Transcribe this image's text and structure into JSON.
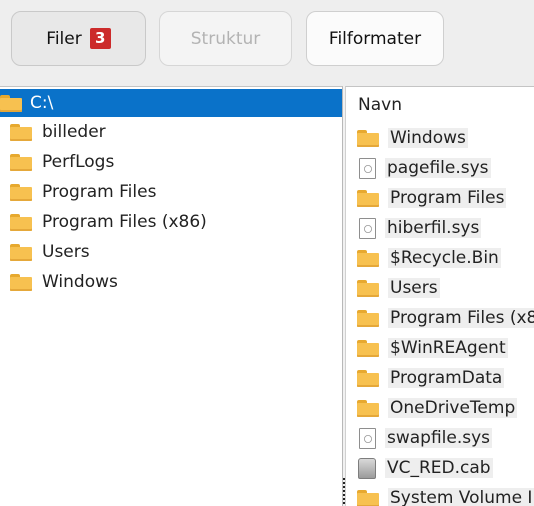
{
  "toolbar": {
    "filer_label": "Filer",
    "filer_badge": "3",
    "struktur_label": "Struktur",
    "filformater_label": "Filformater"
  },
  "tree": {
    "root": "C:\\",
    "children": [
      "billeder",
      "PerfLogs",
      "Program Files",
      "Program Files (x86)",
      "Users",
      "Windows"
    ]
  },
  "list": {
    "header": "Navn",
    "items": [
      {
        "name": "Windows",
        "icon": "folder-icon"
      },
      {
        "name": "pagefile.sys",
        "icon": "system-file-icon"
      },
      {
        "name": "Program Files",
        "icon": "folder-icon"
      },
      {
        "name": "hiberfil.sys",
        "icon": "system-file-icon"
      },
      {
        "name": "$Recycle.Bin",
        "icon": "folder-icon"
      },
      {
        "name": "Users",
        "icon": "folder-icon"
      },
      {
        "name": "Program Files (x86",
        "icon": "folder-icon"
      },
      {
        "name": "$WinREAgent",
        "icon": "folder-icon"
      },
      {
        "name": "ProgramData",
        "icon": "folder-icon"
      },
      {
        "name": "OneDriveTemp",
        "icon": "folder-icon"
      },
      {
        "name": "swapfile.sys",
        "icon": "system-file-icon"
      },
      {
        "name": "VC_RED.cab",
        "icon": "cab-file-icon"
      },
      {
        "name": "System Volume Inf",
        "icon": "folder-icon"
      }
    ]
  },
  "colors": {
    "selection": "#0a72c9",
    "badge": "#cc2b2b",
    "folder": "#f7c150"
  }
}
